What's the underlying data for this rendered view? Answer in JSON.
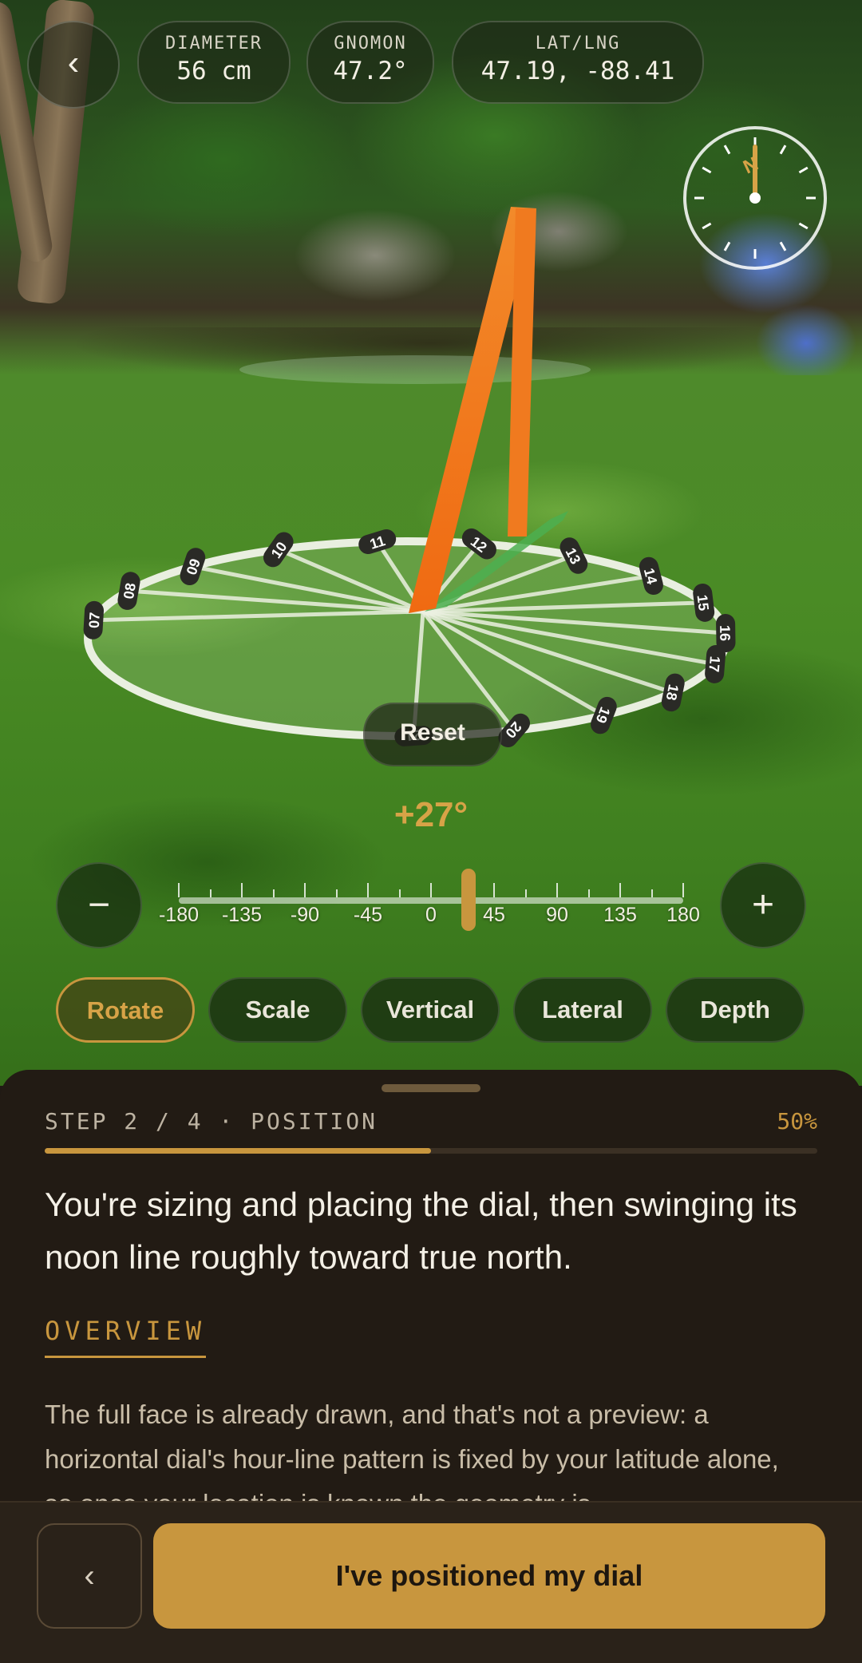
{
  "hud": {
    "back_icon": "‹",
    "diameter": {
      "label": "DIAMETER",
      "value": "56 cm"
    },
    "gnomon": {
      "label": "GNOMON",
      "value": "47.2°"
    },
    "latlng": {
      "label": "LAT/LNG",
      "value": "47.19, -88.41"
    },
    "compass_letter": "N"
  },
  "dial": {
    "hour_labels": [
      "07",
      "08",
      "09",
      "10",
      "11",
      "12",
      "13",
      "14",
      "15",
      "16",
      "17",
      "18",
      "19",
      "20",
      "21"
    ],
    "reset_label": "Reset"
  },
  "rotation": {
    "readout": "+27°",
    "value_deg": 27,
    "min": -180,
    "max": 180,
    "ticks": [
      "-180",
      "-135",
      "-90",
      "-45",
      "0",
      "45",
      "90",
      "135",
      "180"
    ],
    "minus_label": "−",
    "plus_label": "+"
  },
  "modes": [
    {
      "label": "Rotate",
      "active": true
    },
    {
      "label": "Scale",
      "active": false
    },
    {
      "label": "Vertical",
      "active": false
    },
    {
      "label": "Lateral",
      "active": false
    },
    {
      "label": "Depth",
      "active": false
    }
  ],
  "sheet": {
    "step": "STEP 2 / 4 · POSITION",
    "percent_label": "50%",
    "progress": 0.5,
    "headline": "You're sizing and placing the dial, then swinging its noon line roughly toward true north.",
    "section_title": "OVERVIEW",
    "body": "The full face is already drawn, and that's not a preview: a horizontal dial's hour-line pattern is fixed by your latitude alone, so once your location is known the geometry is"
  },
  "footer": {
    "back_icon": "‹",
    "primary_label": "I've positioned my dial"
  },
  "colors": {
    "accent": "#c8963e",
    "gnomon": "#f07a1f",
    "shadow_line": "#4caf50",
    "sheet_bg": "#221b14"
  }
}
